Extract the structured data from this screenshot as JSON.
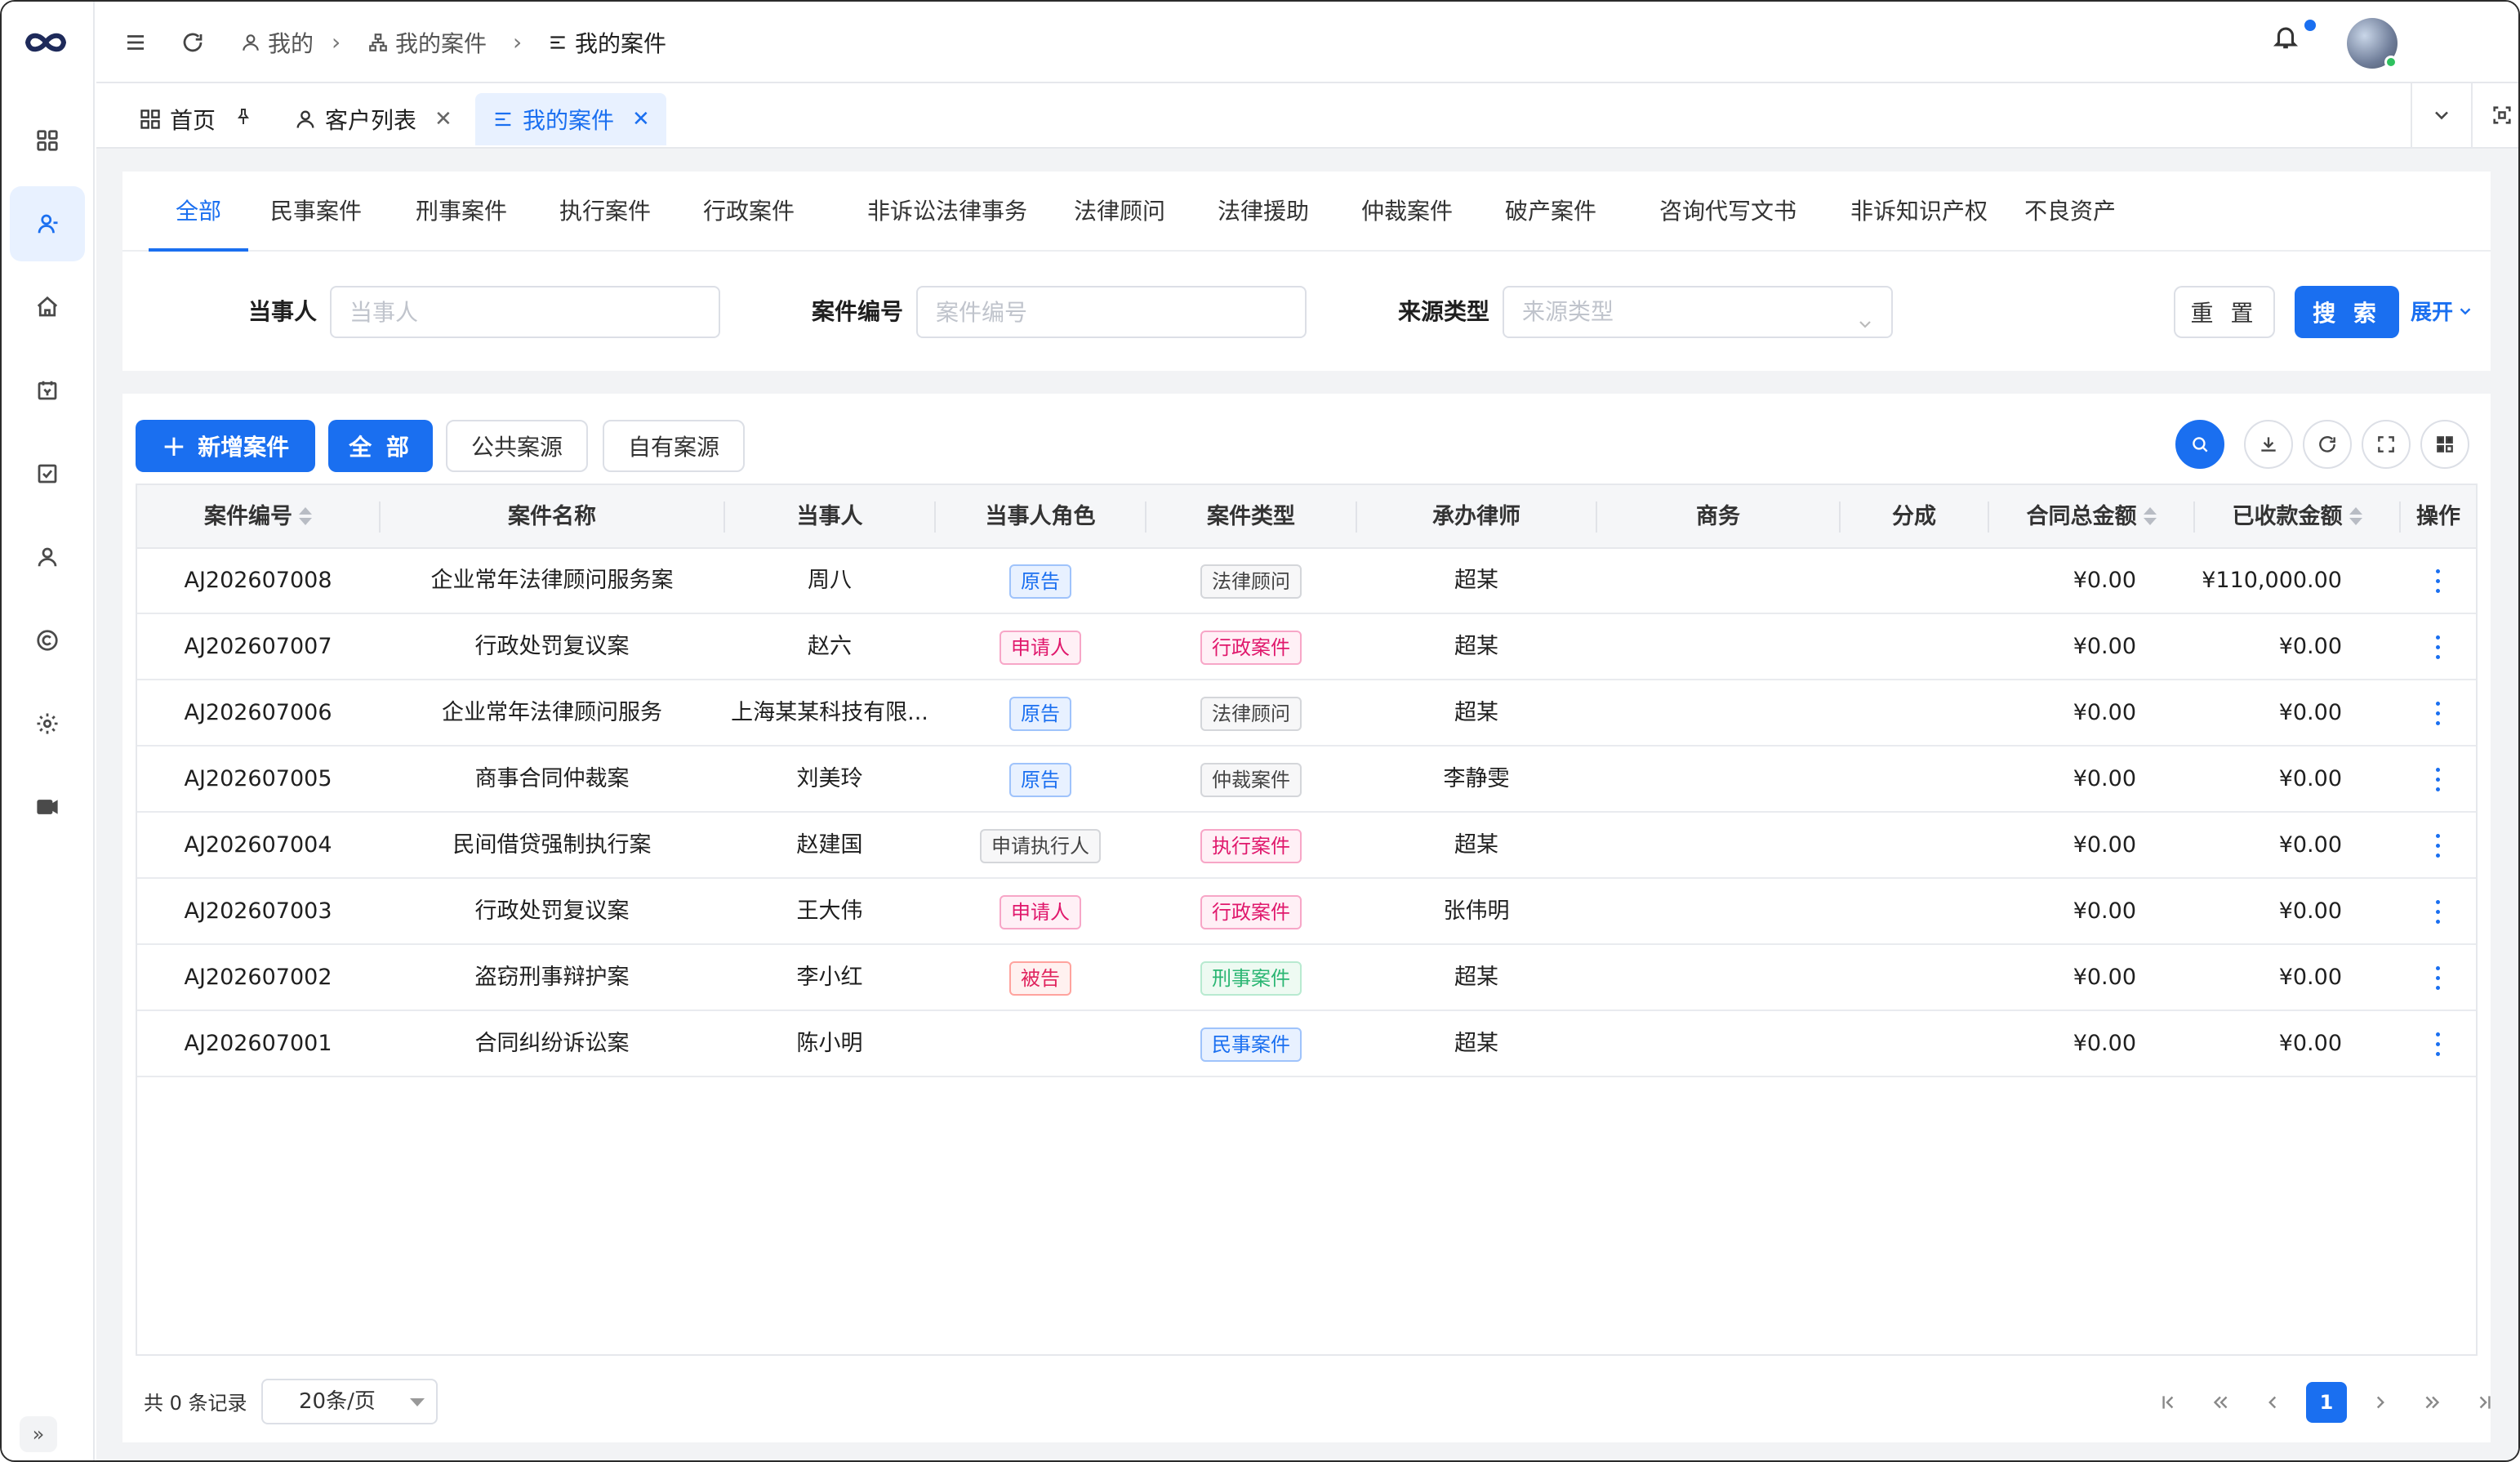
{
  "breadcrumb": [
    "我的",
    "我的案件",
    "我的案件"
  ],
  "page_tabs": [
    {
      "label": "首页",
      "icon": "dashboard-icon",
      "pinned": true
    },
    {
      "label": "客户列表",
      "icon": "user-icon",
      "closable": true
    },
    {
      "label": "我的案件",
      "icon": "list-icon",
      "closable": true,
      "active": true
    }
  ],
  "case_categories": [
    "全部",
    "民事案件",
    "刑事案件",
    "执行案件",
    "行政案件",
    "非诉讼法律事务",
    "法律顾问",
    "法律援助",
    "仲裁案件",
    "破产案件",
    "咨询代写文书",
    "非诉知识产权",
    "不良资产"
  ],
  "filters": {
    "party_label": "当事人",
    "party_placeholder": "当事人",
    "case_no_label": "案件编号",
    "case_no_placeholder": "案件编号",
    "source_label": "来源类型",
    "source_placeholder": "来源类型",
    "reset": "重 置",
    "search": "搜 索",
    "expand": "展开"
  },
  "toolbar": {
    "new_case": "新增案件",
    "all": "全 部",
    "public_source": "公共案源",
    "own_source": "自有案源"
  },
  "table": {
    "columns": [
      "案件编号",
      "案件名称",
      "当事人",
      "当事人角色",
      "案件类型",
      "承办律师",
      "商务",
      "分成",
      "合同总金额",
      "已收款金额",
      "操作"
    ],
    "rows": [
      {
        "no": "AJ202607008",
        "name": "企业常年法律顾问服务案",
        "party": "周八",
        "role": "原告",
        "type": "法律顾问",
        "lawyer": "超某",
        "biz": "",
        "share": "",
        "contract": "¥0.00",
        "received": "¥110,000.00"
      },
      {
        "no": "AJ202607007",
        "name": "行政处罚复议案",
        "party": "赵六",
        "role": "申请人",
        "type": "行政案件",
        "lawyer": "超某",
        "biz": "",
        "share": "",
        "contract": "¥0.00",
        "received": "¥0.00"
      },
      {
        "no": "AJ202607006",
        "name": "企业常年法律顾问服务",
        "party": "上海某某科技有限...",
        "role": "原告",
        "type": "法律顾问",
        "lawyer": "超某",
        "biz": "",
        "share": "",
        "contract": "¥0.00",
        "received": "¥0.00"
      },
      {
        "no": "AJ202607005",
        "name": "商事合同仲裁案",
        "party": "刘美玲",
        "role": "原告",
        "type": "仲裁案件",
        "lawyer": "李静雯",
        "biz": "",
        "share": "",
        "contract": "¥0.00",
        "received": "¥0.00"
      },
      {
        "no": "AJ202607004",
        "name": "民间借贷强制执行案",
        "party": "赵建国",
        "role": "申请执行人",
        "type": "执行案件",
        "lawyer": "超某",
        "biz": "",
        "share": "",
        "contract": "¥0.00",
        "received": "¥0.00"
      },
      {
        "no": "AJ202607003",
        "name": "行政处罚复议案",
        "party": "王大伟",
        "role": "申请人",
        "type": "行政案件",
        "lawyer": "张伟明",
        "biz": "",
        "share": "",
        "contract": "¥0.00",
        "received": "¥0.00"
      },
      {
        "no": "AJ202607002",
        "name": "盗窃刑事辩护案",
        "party": "李小红",
        "role": "被告",
        "type": "刑事案件",
        "lawyer": "超某",
        "biz": "",
        "share": "",
        "contract": "¥0.00",
        "received": "¥0.00"
      },
      {
        "no": "AJ202607001",
        "name": "合同纠纷诉讼案",
        "party": "陈小明",
        "role": "",
        "type": "民事案件",
        "lawyer": "超某",
        "biz": "",
        "share": "",
        "contract": "¥0.00",
        "received": "¥0.00"
      }
    ]
  },
  "pagination": {
    "total": "共 0 条记录",
    "page_size": "20条/页",
    "current_page": "1"
  },
  "colors": {
    "primary": "#1a6ff0",
    "tag_blue": "#1a6ff0",
    "tag_pink": "#e0186c",
    "tag_green": "#2bb673",
    "notification_dot": "#1a6ff0",
    "online_dot": "#2fc15f"
  }
}
